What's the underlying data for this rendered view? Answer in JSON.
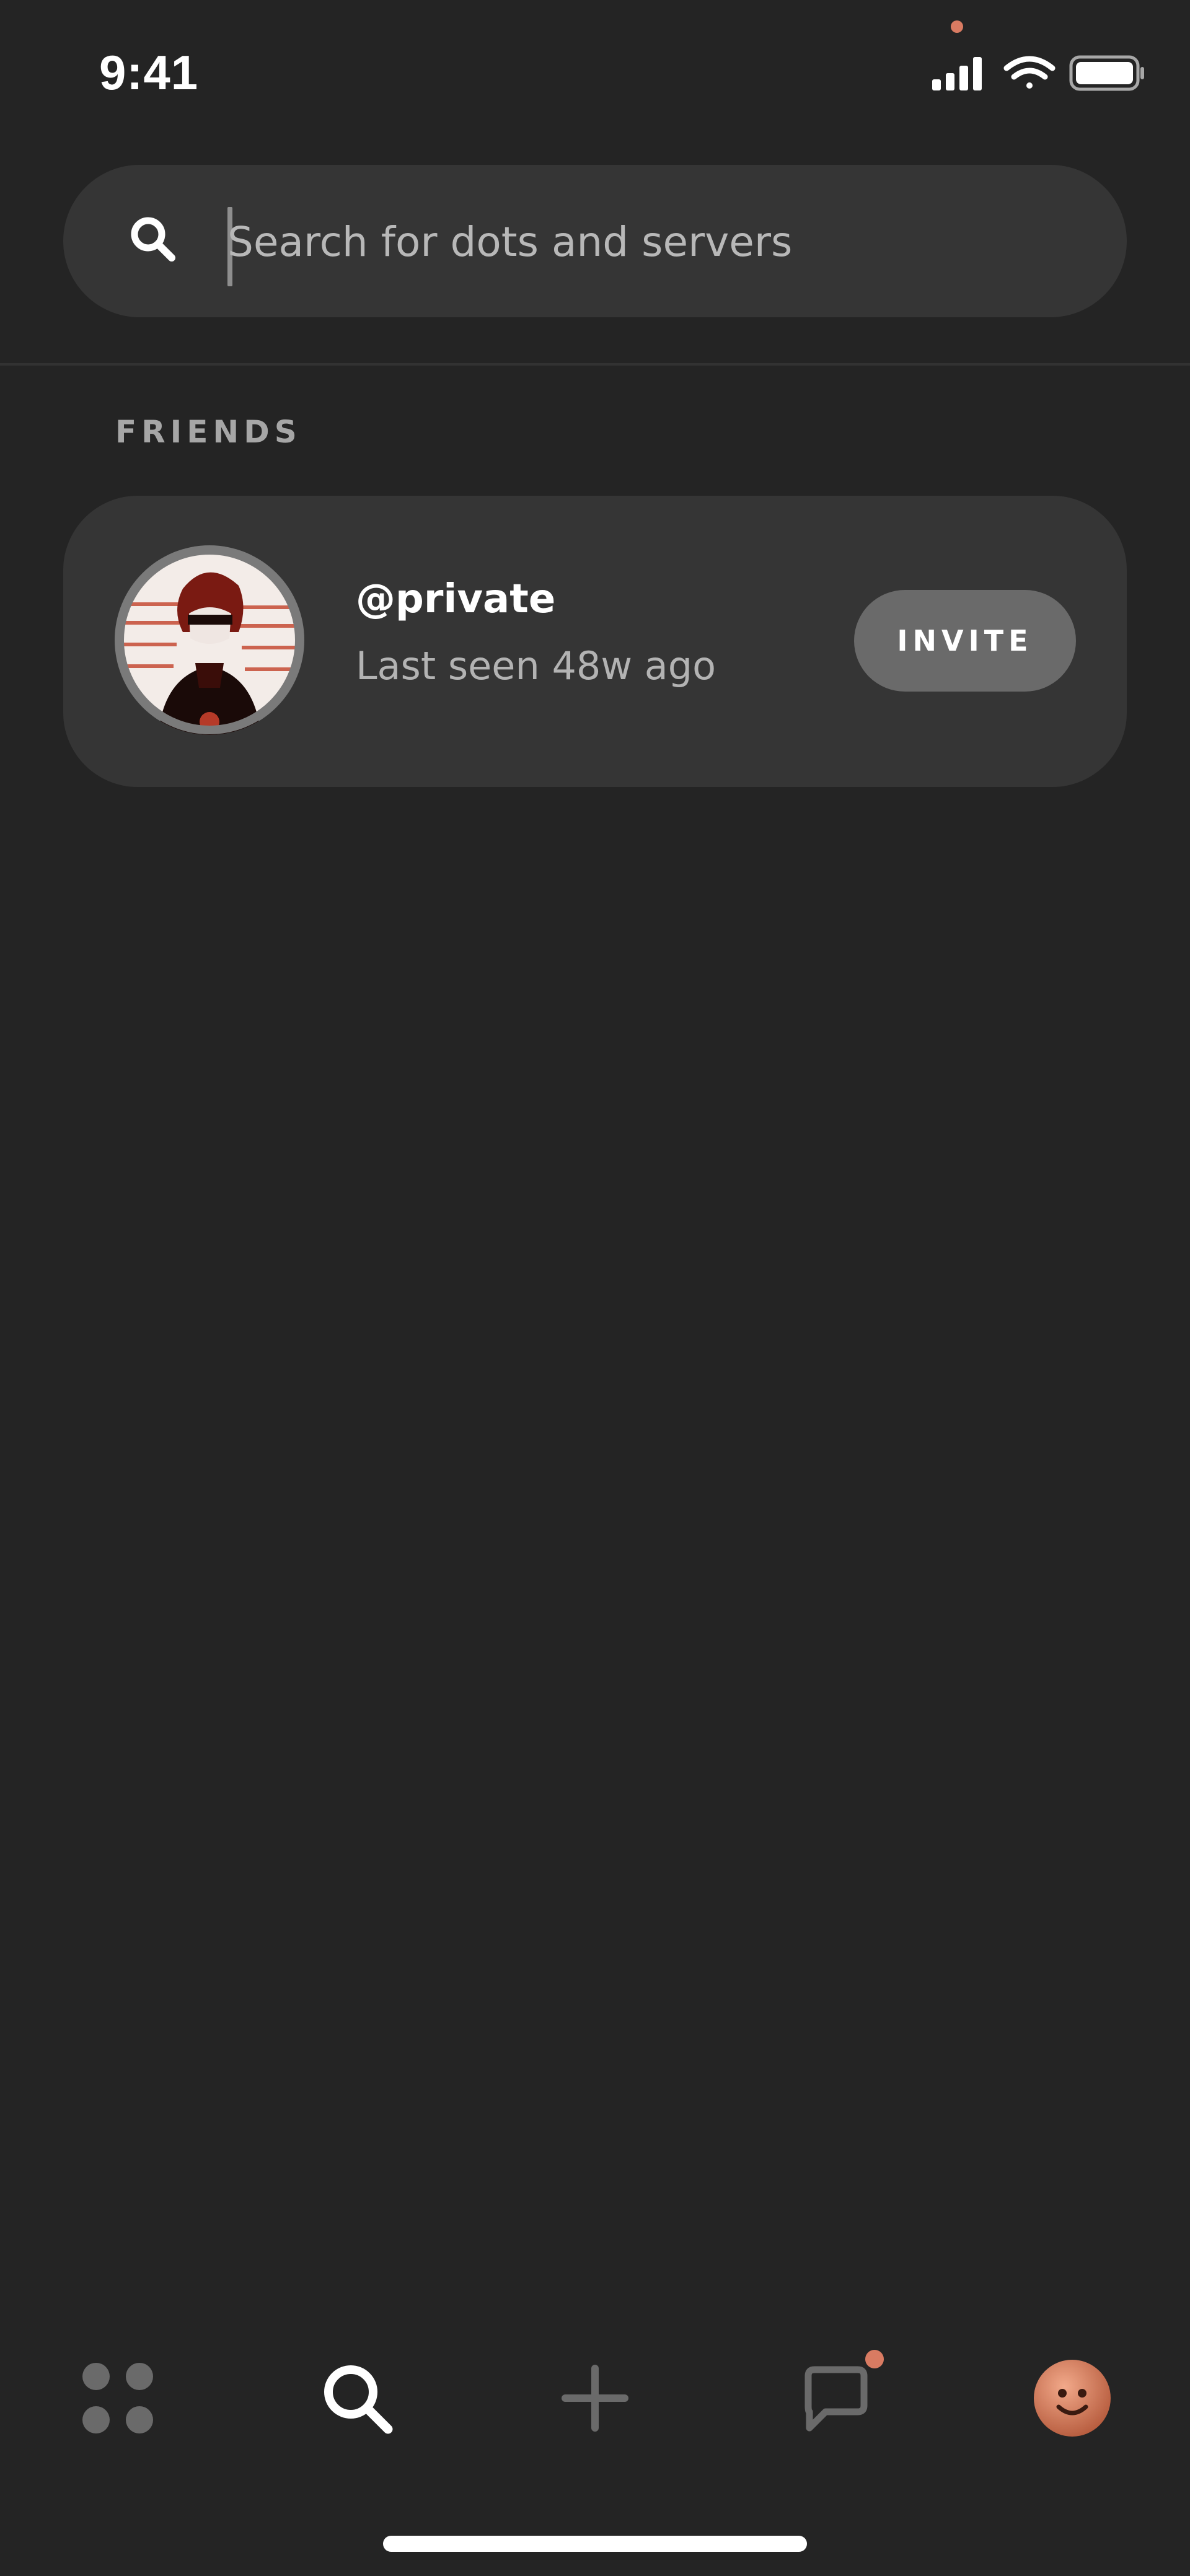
{
  "status_bar": {
    "time": "9:41",
    "icons": [
      "cellular-signal-icon",
      "wifi-icon",
      "battery-icon"
    ],
    "notification_dot_color": "#d97b62"
  },
  "search": {
    "placeholder": "Search for dots and servers",
    "value": "",
    "icon": "search-icon"
  },
  "friends": {
    "section_title": "FRIENDS",
    "items": [
      {
        "username": "@private",
        "last_seen": "Last seen 48w ago",
        "action_label": "INVITE",
        "avatar": "avatar-image"
      }
    ]
  },
  "tab_bar": {
    "tabs": [
      {
        "name": "dots",
        "icon": "grid-dots-icon",
        "active": false
      },
      {
        "name": "search",
        "icon": "search-icon",
        "active": true
      },
      {
        "name": "create",
        "icon": "plus-icon",
        "active": false
      },
      {
        "name": "messages",
        "icon": "chat-bubble-icon",
        "active": false,
        "badge": true
      },
      {
        "name": "profile",
        "icon": "profile-avatar-icon",
        "active": false
      }
    ]
  },
  "colors": {
    "background": "#242424",
    "card": "#353535",
    "accent": "#d97b62",
    "button": "#6a6a6a",
    "muted_text": "#b3b3b3"
  }
}
